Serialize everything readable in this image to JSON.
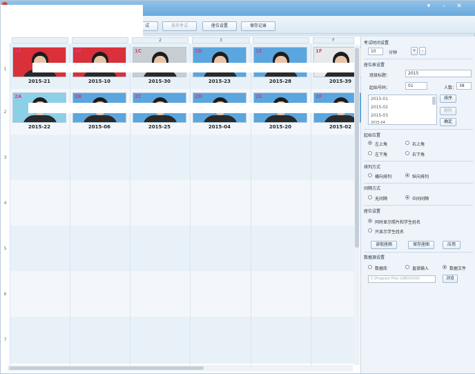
{
  "window": {
    "title_controls": [
      "▾",
      "–",
      "✕"
    ]
  },
  "toolbar": {
    "btn1": "试",
    "btn2": "放弃考试",
    "btn3": "座位设置",
    "btn4": "保存记录"
  },
  "grid": {
    "columns": [
      "",
      "",
      "2",
      "3",
      "",
      "F"
    ],
    "row_numbers": [
      "1",
      "2",
      "3",
      "4",
      "5",
      "6",
      "7"
    ],
    "seats": [
      {
        "code": "1A",
        "id": "2015-21",
        "bg": "#d9303a"
      },
      {
        "code": "1B",
        "id": "2015-10",
        "bg": "#d9303a"
      },
      {
        "code": "1C",
        "id": "2015-30",
        "bg": "#c7cdd2"
      },
      {
        "code": "1D",
        "id": "2015-23",
        "bg": "#5ba6de"
      },
      {
        "code": "1E",
        "id": "2015-28",
        "bg": "#5ba6de"
      },
      {
        "code": "1F",
        "id": "2015-39",
        "bg": "#e8e9ea"
      },
      {
        "code": "2A",
        "id": "2015-22",
        "bg": "#8cd0e8"
      },
      {
        "code": "2B",
        "id": "2015-06",
        "bg": "#5ba6de"
      },
      {
        "code": "2C",
        "id": "2015-25",
        "bg": "#5ba6de"
      },
      {
        "code": "2D",
        "id": "2015-04",
        "bg": "#5ba6de"
      },
      {
        "code": "2E",
        "id": "2015-20",
        "bg": "#5ba6de"
      },
      {
        "code": "2F",
        "id": "2015-02",
        "bg": "#5ba6de"
      }
    ]
  },
  "panel": {
    "sect_time": "考试时间设置",
    "time_value": "10",
    "time_unit": "分钟",
    "sect_seat": "座位表设置",
    "class_label": "班级标题：",
    "class_value": "2015",
    "start_label": "起始号码：",
    "start_value": "01",
    "count_label": "人数：",
    "count_value": "38",
    "list_items": [
      "2015-01",
      "2015-02",
      "2015-03",
      "2015-04"
    ],
    "btn_sort": "排序",
    "btn_delete": "删除",
    "btn_ok": "确定",
    "sect_start": "起始位置",
    "start_opts": [
      "左上角",
      "右上角",
      "左下角",
      "右下角"
    ],
    "sect_order": "排列方式",
    "order_opts": [
      "横向排列",
      "纵向排列"
    ],
    "sect_gap": "间隔方式",
    "gap_opts": [
      "无间隔",
      "中间间隔"
    ],
    "sect_photo": "座位设置",
    "photo_opts": [
      "同时显示照片和学生姓名",
      "只显示学生姓名"
    ],
    "btn_read": "读取座图",
    "btn_save": "保存座图",
    "btn_apply": "应用",
    "sect_source": "数据源设置",
    "source_opts": [
      "数据库",
      "直接输入",
      "数据文件"
    ],
    "path_value": "C:\\Program Files (x86)\\XXXX",
    "btn_browse": "浏览"
  }
}
